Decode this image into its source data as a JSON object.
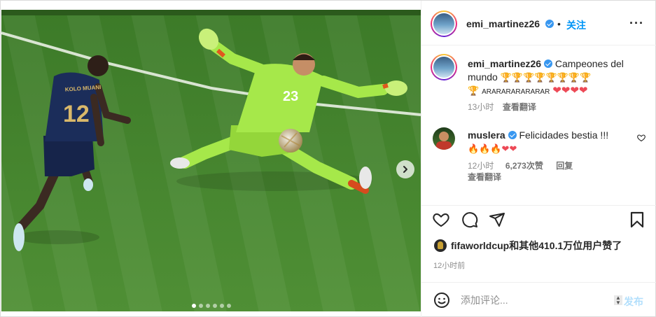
{
  "post": {
    "dots_count": 6,
    "active_dot": 0,
    "jersey_number_keeper": "23",
    "jersey_number_striker": "12",
    "jersey_name_striker": "KOLO MUANI"
  },
  "header": {
    "username": "emi_martinez26",
    "separator": "•",
    "follow_label": "关注",
    "more_label": "···"
  },
  "caption": {
    "username": "emi_martinez26",
    "text_line1": "Campeones del",
    "text_line2_word": "mundo",
    "trophies_line2": "🏆🏆🏆🏆🏆🏆🏆🏆",
    "trophy_line3": "🏆",
    "small_text": "ARARARARARARAR",
    "hearts": "❤❤❤❤",
    "time": "13小时",
    "translate": "查看翻译"
  },
  "comment": {
    "username": "muslera",
    "text": "Felicidades bestia !!!",
    "emojis": "🔥🔥🔥❤❤",
    "time": "12小时",
    "likes": "6,273次赞",
    "reply": "回复",
    "translate": "查看翻译"
  },
  "likes_line": {
    "user": "fifaworldcup",
    "rest": "和其他410.1万位用户赞了"
  },
  "time_ago": "12小时前",
  "comment_box": {
    "placeholder": "添加评论...",
    "post_label": "发布"
  },
  "colors": {
    "accent": "#0095f6",
    "verified": "#3897f0",
    "heart": "#ed4956",
    "pitch": "#4a8a33",
    "keeper_kit": "#a6e84a",
    "striker_kit": "#1b2d5a"
  }
}
